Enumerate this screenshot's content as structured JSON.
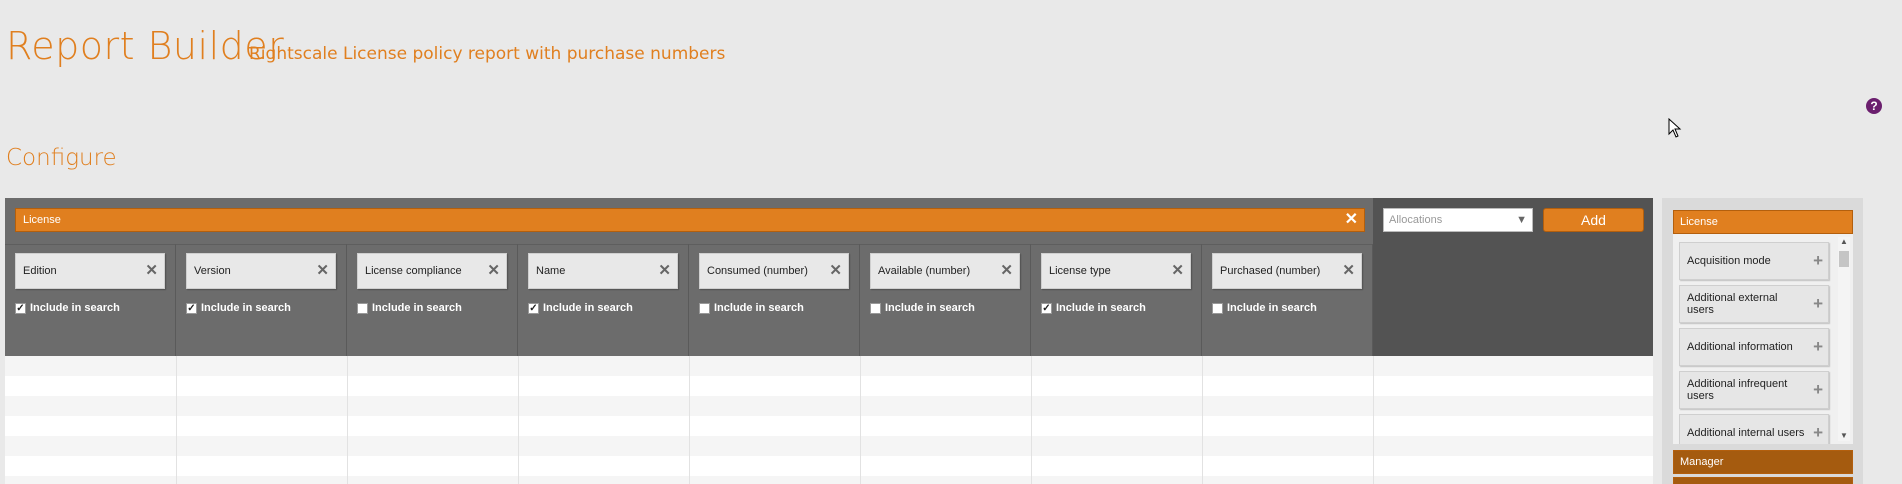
{
  "header": {
    "title": "Report Builder",
    "subtitle": "Rightscale License policy report with purchase numbers",
    "help_icon": "?"
  },
  "section": {
    "title": "Configure"
  },
  "entity": {
    "label": "License",
    "close_icon": "✕"
  },
  "include_label": "Include in search",
  "columns": [
    {
      "label": "Edition",
      "checked": true
    },
    {
      "label": "Version",
      "checked": true
    },
    {
      "label": "License compliance",
      "checked": false
    },
    {
      "label": "Name",
      "checked": true
    },
    {
      "label": "Consumed (number)",
      "checked": false
    },
    {
      "label": "Available (number)",
      "checked": false
    },
    {
      "label": "License type",
      "checked": true
    },
    {
      "label": "Purchased (number)",
      "checked": false
    }
  ],
  "relation": {
    "selected": "Allocations",
    "caret_icon": "▼",
    "add_label": "Add"
  },
  "panel": {
    "groups": [
      "License",
      "Manager"
    ],
    "items": [
      "Acquisition mode",
      "Additional external users",
      "Additional information",
      "Additional infrequent users",
      "Additional internal users"
    ],
    "plus_icon": "+"
  },
  "colors": {
    "accent": "#e07f1f",
    "accent_dark": "#a55b0f",
    "help": "#6b1f6e"
  }
}
